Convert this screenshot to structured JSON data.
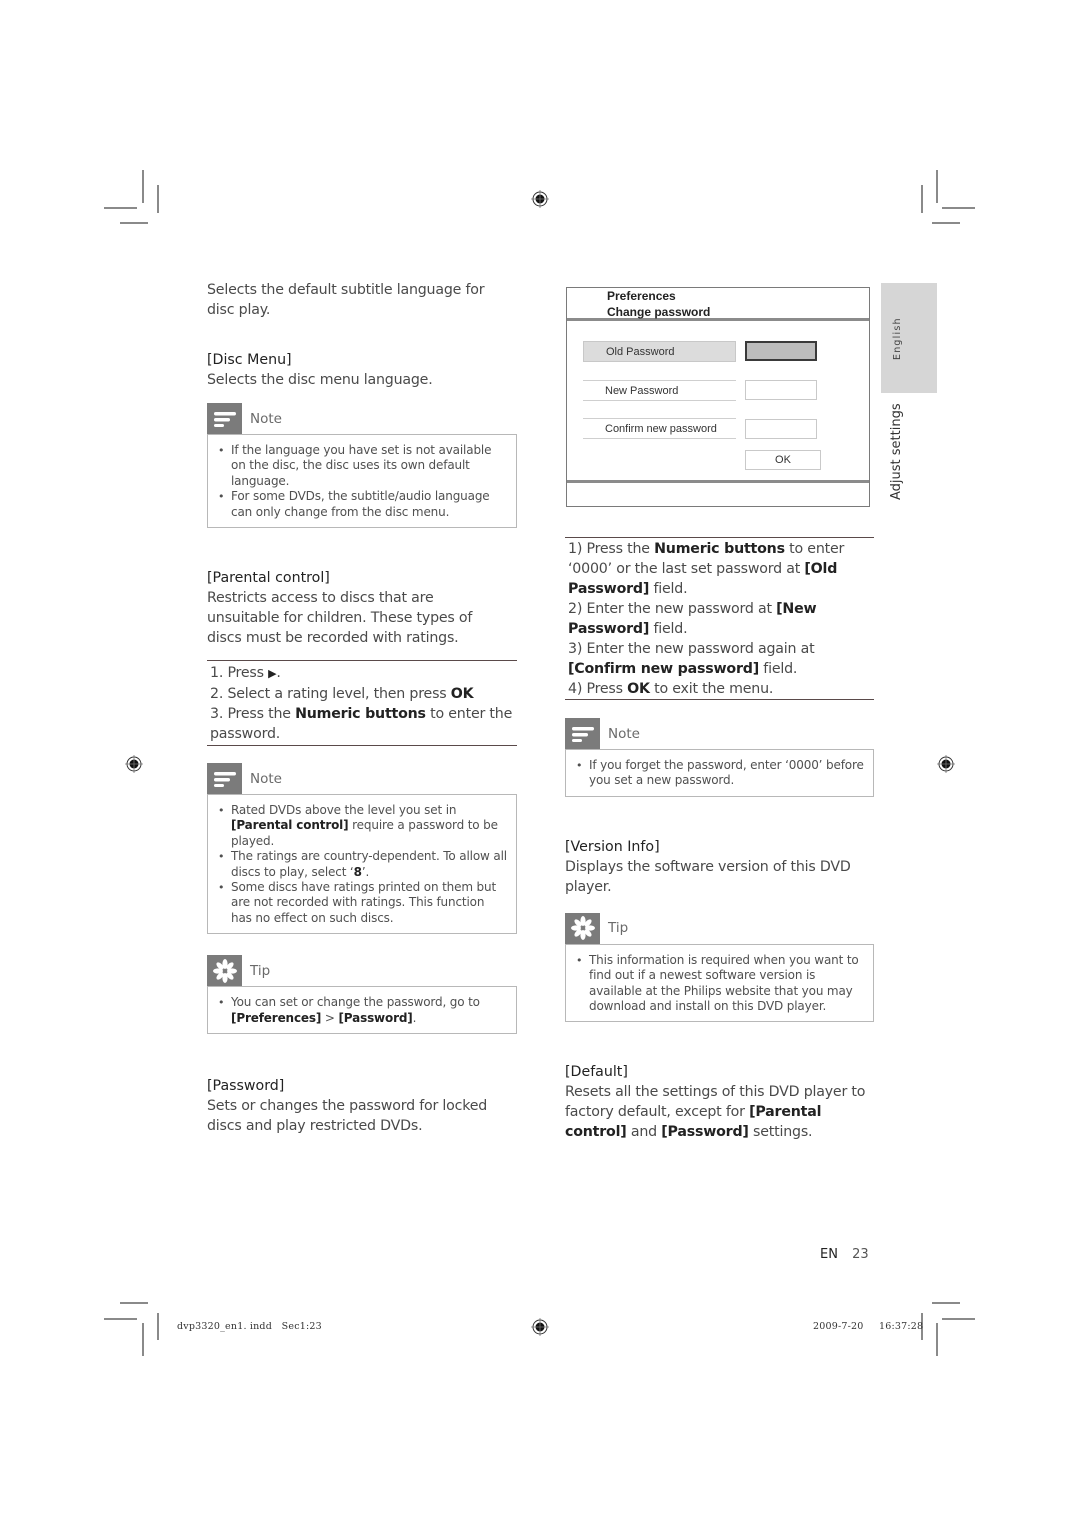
{
  "left_column": {
    "intro_text": "Selects the default subtitle language for disc play.",
    "disc_menu": {
      "heading": "[Disc Menu]",
      "description": "Selects the disc menu language."
    },
    "note1": {
      "icon": "note-icon",
      "title": "Note",
      "items": [
        "If the language you have set is not available on the disc, the disc uses its own default language.",
        "For some DVDs, the subtitle/audio language can only change from the disc menu."
      ]
    },
    "parental_control": {
      "heading": "[Parental control]",
      "description": "Restricts access to discs that are unsuitable for children. These types of discs must be recorded with ratings.",
      "steps": {
        "step1_prefix": "1. Press ",
        "step1_symbol": "▶",
        "step1_suffix": ".",
        "step2_prefix": "2. Select a rating level, then press ",
        "step2_bold": "OK",
        "step3_prefix": "3. Press the ",
        "step3_bold": "Numeric buttons",
        "step3_suffix": " to enter the password."
      }
    },
    "note2": {
      "icon": "note-icon",
      "title": "Note",
      "item1_prefix": "Rated DVDs above the level you set in ",
      "item1_bold": "[Parental control]",
      "item1_suffix": " require a password to be played.",
      "item2_prefix": "The ratings are country-dependent. To allow all discs to play, select ‘",
      "item2_bold": "8",
      "item2_suffix": "’.",
      "item3": "Some discs have ratings printed on them but are not recorded with ratings. This function has no effect on such discs."
    },
    "tip1": {
      "icon": "tip-icon",
      "title": "Tip",
      "item_prefix": "You can set or change the password, go to ",
      "item_bold1": "[Preferences]",
      "item_sep": " > ",
      "item_bold2": "[Password]",
      "item_suffix": "."
    },
    "password": {
      "heading": "[Password]",
      "description": "Sets or changes the password for locked discs and play restricted DVDs."
    }
  },
  "menu_screen": {
    "title1": "Preferences",
    "title2": "Change password",
    "old_password_label": "Old Password",
    "new_password_label": "New Password",
    "confirm_password_label": "Confirm new password",
    "ok_label": "OK",
    "old_password_value": "",
    "new_password_value": "",
    "confirm_password_value": ""
  },
  "right_column": {
    "steps": {
      "s1_prefix": "1) Press the ",
      "s1_bold": "Numeric buttons",
      "s1_mid": " to enter ‘0000’ or the last set password at ",
      "s1_bold2": "[Old Password]",
      "s1_suffix": " field.",
      "s2_prefix": "2) Enter the new password at ",
      "s2_bold": "[New Password]",
      "s2_suffix": " field.",
      "s3_prefix": "3) Enter the new password again at ",
      "s3_bold": "[Confirm new password]",
      "s3_suffix": " field.",
      "s4_prefix": "4) Press ",
      "s4_bold": "OK",
      "s4_suffix": " to exit the menu."
    },
    "note": {
      "icon": "note-icon",
      "title": "Note",
      "item": "If you forget the password, enter ‘0000’ before you set a new password."
    },
    "version_info": {
      "heading": "[Version Info]",
      "description": "Displays the software version of this DVD player."
    },
    "tip": {
      "icon": "tip-icon",
      "title": "Tip",
      "item": "This information is required when you want to find out if a newest software version is available at the Philips website that you may download and install on this DVD player."
    },
    "default": {
      "heading": "[Default]",
      "desc_prefix": "Resets all the settings of this DVD player to factory default, except for ",
      "desc_bold1": "[Parental control]",
      "desc_mid": " and ",
      "desc_bold2": "[Password]",
      "desc_suffix": " settings."
    }
  },
  "side_tab": {
    "language": "English",
    "section": "Adjust settings"
  },
  "footer": {
    "lang": "EN",
    "page_number": "23",
    "file_info": "dvp3320_en1. indd   Sec1:23",
    "date": "2009-7-20",
    "time": "16:37:28"
  },
  "colors": {
    "icon_box": "#7b7b7b",
    "side_tab": "#d6d6d6",
    "text": "#4a4a4a"
  }
}
